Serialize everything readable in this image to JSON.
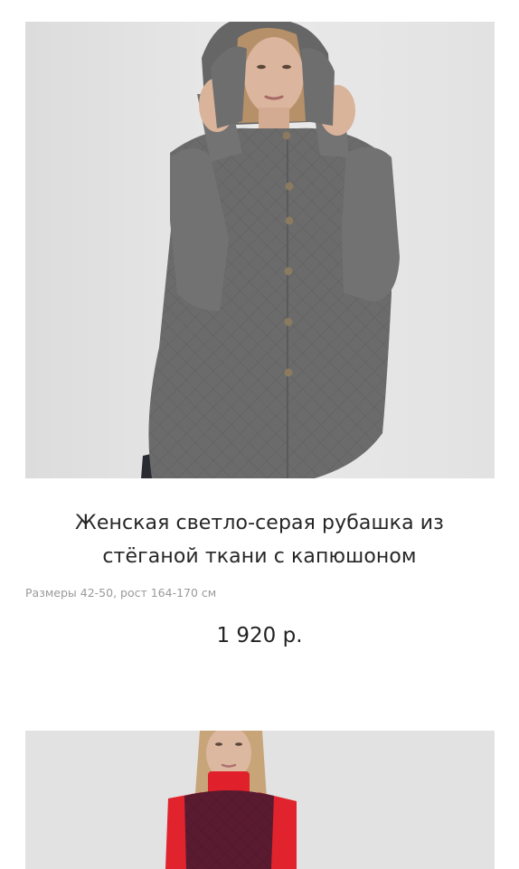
{
  "products": [
    {
      "title": "Женская светло-серая рубашка из стёганой ткани с капюшоном",
      "meta": "Размеры 42-50, рост 164-170 см",
      "price": "1 920 р.",
      "image_colors": {
        "background": "#e3e3e3",
        "garment": "#6a6a6a",
        "skin": "#d9b49c",
        "hair": "#b69068"
      }
    },
    {
      "image_colors": {
        "background": "#e1e1e1",
        "vest": "#5a1b30",
        "turtleneck": "#e0202a",
        "hair": "#c7a478",
        "skin": "#dcb7a0"
      }
    }
  ]
}
